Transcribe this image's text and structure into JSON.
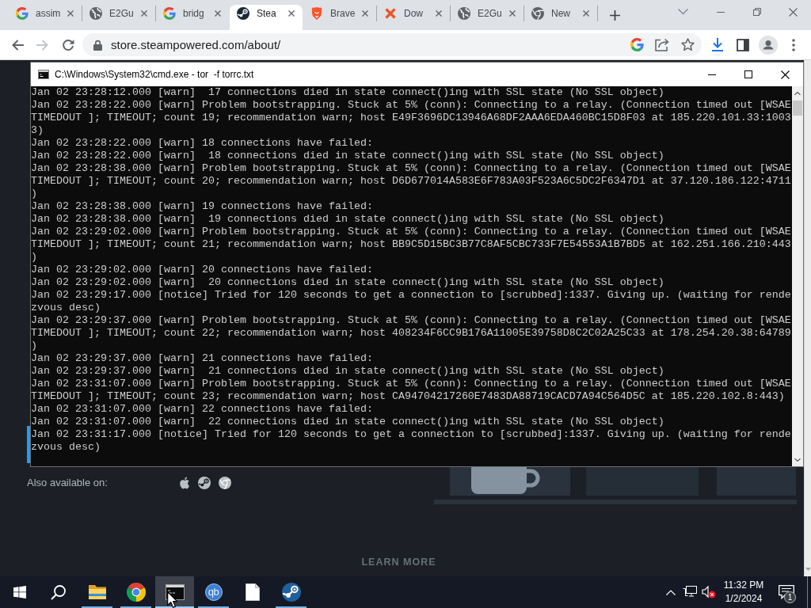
{
  "browser": {
    "tabs": [
      {
        "kind": "g-logo",
        "title": "assim",
        "selected": false
      },
      {
        "kind": "globe",
        "title": "E2Gu",
        "selected": false
      },
      {
        "kind": "g-logo",
        "title": "bridg",
        "selected": false
      },
      {
        "kind": "steam",
        "title": "Stea",
        "selected": true
      },
      {
        "kind": "lion-shield",
        "title": "Brave",
        "selected": false
      },
      {
        "kind": "x-mark",
        "title": "Dow",
        "selected": false
      },
      {
        "kind": "globe",
        "title": "E2Gu",
        "selected": false
      },
      {
        "kind": "chrome",
        "title": "New",
        "selected": false
      }
    ],
    "nav_buttons": [
      {
        "kind": "back",
        "disabled": false
      },
      {
        "kind": "forward",
        "disabled": true
      },
      {
        "kind": "reload",
        "disabled": false
      }
    ],
    "address_bar": {
      "url": "store.steampowered.com/about/"
    }
  },
  "page": {
    "also_available_label": "Also available on:",
    "platforms": [
      {
        "kind": "apple"
      },
      {
        "kind": "steam"
      },
      {
        "kind": "chrome"
      }
    ],
    "learn_more": "LEARN MORE"
  },
  "console_window": {
    "title": "C:\\Windows\\System32\\cmd.exe - tor  -f torrc.txt",
    "lines": [
      "Jan 02 23:28:12.000 [warn]  17 connections died in state connect()ing with SSL state (No SSL object)",
      "Jan 02 23:28:22.000 [warn] Problem bootstrapping. Stuck at 5% (conn): Connecting to a relay. (Connection timed out [WSAETIMEDOUT ]; TIMEOUT; count 19; recommendation warn; host E49F3696DC13946A68DF2AAA6EDA460BC15D8F03 at 185.220.101.33:10033)",
      "Jan 02 23:28:22.000 [warn] 18 connections have failed:",
      "Jan 02 23:28:22.000 [warn]  18 connections died in state connect()ing with SSL state (No SSL object)",
      "Jan 02 23:28:38.000 [warn] Problem bootstrapping. Stuck at 5% (conn): Connecting to a relay. (Connection timed out [WSAETIMEDOUT ]; TIMEOUT; count 20; recommendation warn; host D6D677014A583E6F783A03F523A6C5DC2F6347D1 at 37.120.186.122:4711)",
      "Jan 02 23:28:38.000 [warn] 19 connections have failed:",
      "Jan 02 23:28:38.000 [warn]  19 connections died in state connect()ing with SSL state (No SSL object)",
      "Jan 02 23:29:02.000 [warn] Problem bootstrapping. Stuck at 5% (conn): Connecting to a relay. (Connection timed out [WSAETIMEDOUT ]; TIMEOUT; count 21; recommendation warn; host BB9C5D15BC3B77C8AF5CBC733F7E54553A1B7BD5 at 162.251.166.210:443)",
      "Jan 02 23:29:02.000 [warn] 20 connections have failed:",
      "Jan 02 23:29:02.000 [warn]  20 connections died in state connect()ing with SSL state (No SSL object)",
      "Jan 02 23:29:17.000 [notice] Tried for 120 seconds to get a connection to [scrubbed]:1337. Giving up. (waiting for rendezvous desc)",
      "Jan 02 23:29:37.000 [warn] Problem bootstrapping. Stuck at 5% (conn): Connecting to a relay. (Connection timed out [WSAETIMEDOUT ]; TIMEOUT; count 22; recommendation warn; host 408234F6CC9B176A11005E39758D8C2C02A25C33 at 178.254.20.38:64789)",
      "Jan 02 23:29:37.000 [warn] 21 connections have failed:",
      "Jan 02 23:29:37.000 [warn]  21 connections died in state connect()ing with SSL state (No SSL object)",
      "Jan 02 23:31:07.000 [warn] Problem bootstrapping. Stuck at 5% (conn): Connecting to a relay. (Connection timed out [WSAETIMEDOUT ]; TIMEOUT; count 23; recommendation warn; host CA94704217260E7483DA88719CACD7A94C564D5C at 185.220.102.8:443)",
      "Jan 02 23:31:07.000 [warn] 22 connections have failed:",
      "Jan 02 23:31:07.000 [warn]  22 connections died in state connect()ing with SSL state (No SSL object)",
      "Jan 02 23:31:17.000 [notice] Tried for 120 seconds to get a connection to [scrubbed]:1337. Giving up. (waiting for rendezvous desc)"
    ]
  },
  "taskbar": {
    "apps": [
      {
        "kind": "folder",
        "selected": false,
        "running": true
      },
      {
        "kind": "chrome",
        "selected": false,
        "running": true
      },
      {
        "kind": "terminal",
        "selected": true,
        "running": true
      },
      {
        "kind": "qbittorrent",
        "label": "qb",
        "selected": false,
        "running": true
      },
      {
        "kind": "document",
        "selected": false,
        "running": false
      },
      {
        "kind": "steam",
        "selected": false,
        "running": true
      }
    ],
    "volume": {
      "muted": true
    },
    "clock": {
      "time": "11:32 PM",
      "date": "1/2/2024"
    },
    "notifications": {
      "count": "1"
    }
  }
}
